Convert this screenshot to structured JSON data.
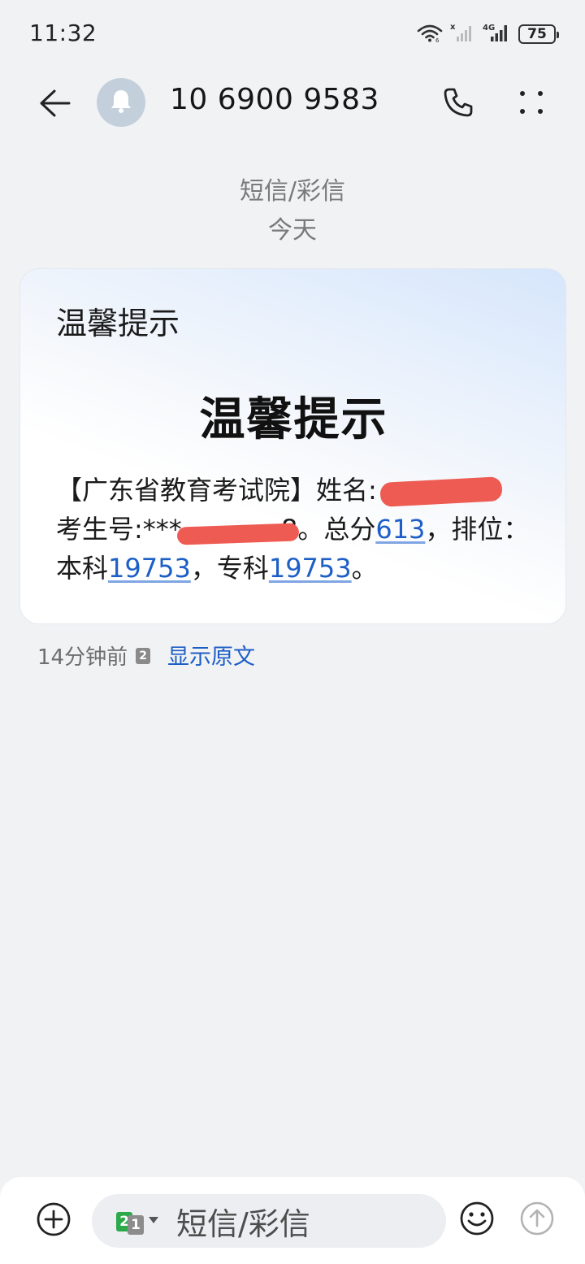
{
  "status_bar": {
    "time": "11:32",
    "battery": "75",
    "network": "4G",
    "icons": [
      "wifi-icon",
      "no-signal-icon",
      "signal-4g-icon",
      "battery-icon"
    ]
  },
  "header": {
    "contact": "10 6900 9583",
    "icons": [
      "back-arrow-icon",
      "bell-icon",
      "phone-icon",
      "more-icon"
    ]
  },
  "thread_meta": {
    "type": "短信/彩信",
    "date": "今天"
  },
  "message": {
    "card_label": "温馨提示",
    "card_title": "温馨提示",
    "body": {
      "line1_prefix": "【广东省教育考试院】姓名:",
      "examinee_label": "考生号:",
      "examinee_visible_start": "***",
      "examinee_visible_end": "8",
      "total_label": "。总分",
      "total_score": "613",
      "rank_label": "，排位：本科",
      "rank_undergrad": "19753",
      "rank_specialist_label": "，专科",
      "rank_specialist": "19753",
      "end": "。"
    },
    "timestamp": "14分钟前",
    "sim_slot": "2",
    "show_original": "显示原文"
  },
  "composer": {
    "placeholder": "短信/彩信",
    "sim_primary": "2",
    "sim_secondary": "1",
    "icons": [
      "add-icon",
      "smile-icon",
      "send-icon"
    ]
  },
  "colors": {
    "accent": "#1e5fc7",
    "redaction": "#ee5b53",
    "background": "#f1f2f4",
    "sim_green": "#2ca94a"
  }
}
